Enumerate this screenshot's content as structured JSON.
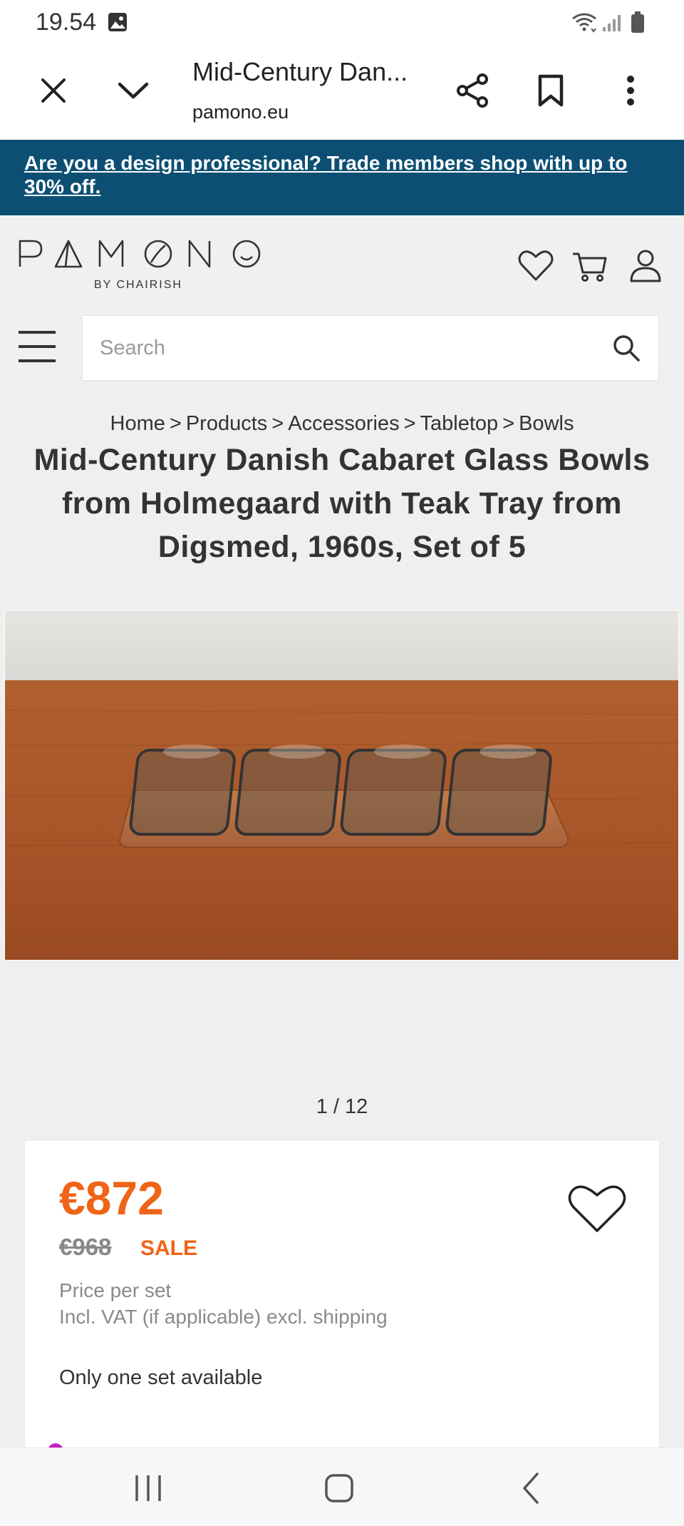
{
  "status_bar": {
    "time": "19.54",
    "icons": [
      "gallery-icon",
      "wifi-icon",
      "signal-icon",
      "battery-icon"
    ]
  },
  "tab_bar": {
    "title": "Mid-Century Dan...",
    "url": "pamono.eu",
    "icons": [
      "close-icon",
      "chevron-down-icon",
      "share-icon",
      "bookmark-icon",
      "more-vertical-icon"
    ]
  },
  "promo": {
    "text": "Are you a design professional? Trade members shop with up to 30% off."
  },
  "header": {
    "brand": "PAMONO",
    "brand_sub": "BY CHAIRISH",
    "search_placeholder": "Search",
    "icons": [
      "heart-icon",
      "cart-icon",
      "user-icon",
      "menu-icon",
      "search-icon"
    ]
  },
  "breadcrumb": [
    "Home",
    "Products",
    "Accessories",
    "Tabletop",
    "Bowls"
  ],
  "breadcrumb_separator": ">",
  "product": {
    "title": "Mid-Century Danish Cabaret Glass Bowls from Holmegaard with Teak Tray from Digsmed, 1960s, Set of 5",
    "image_counter": "1 / 12",
    "price": "€872",
    "old_price": "€968",
    "sale_label": "SALE",
    "price_per": "Price per set",
    "vat_note": "Incl. VAT (if applicable) excl. shipping",
    "availability": "Only one set available"
  },
  "colors": {
    "promo_bg": "#0d4f73",
    "price_orange": "#ef6416",
    "muted_text": "#8a8a8a"
  },
  "nav_bar": {
    "icons": [
      "recent-apps-icon",
      "home-icon",
      "back-icon"
    ]
  }
}
